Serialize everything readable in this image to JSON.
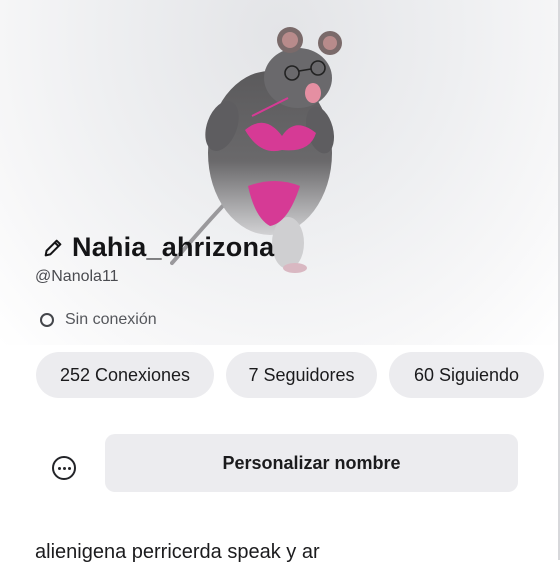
{
  "profile": {
    "display_name": "Nahia_ahrizona",
    "username": "@Nanola11",
    "status": "Sin conexión",
    "bio": "alienigena perricerda speak y ar"
  },
  "stats": {
    "connections": "252 Conexiones",
    "followers": "7 Seguidores",
    "following": "60 Siguiendo"
  },
  "actions": {
    "customize_name": "Personalizar nombre"
  },
  "icons": {
    "edit": "pencil-icon",
    "more": "more-options-icon",
    "status": "offline-status-icon"
  },
  "colors": {
    "chip_bg": "#ececef",
    "text": "#1b1b1d",
    "secondary_text": "#4a4b50"
  }
}
